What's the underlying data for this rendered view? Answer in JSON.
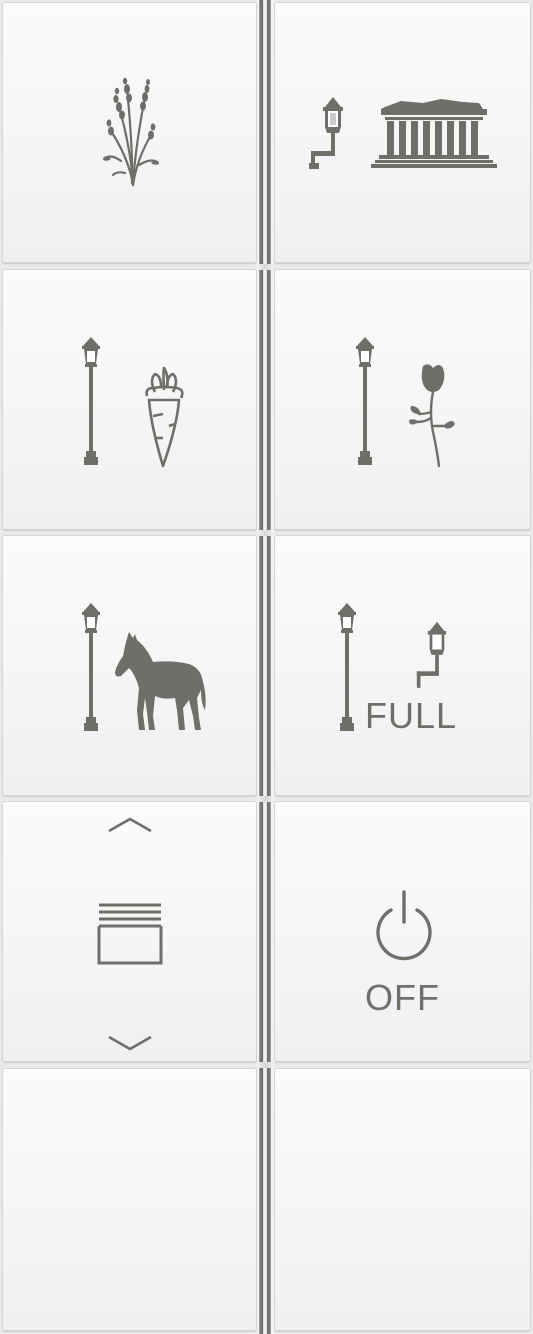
{
  "panel": {
    "icon_color": "#6f6e69",
    "buttons": [
      {
        "id": "b1",
        "icons": [
          "lavender-icon"
        ]
      },
      {
        "id": "b2",
        "icons": [
          "wall-lantern-icon",
          "parthenon-icon"
        ]
      },
      {
        "id": "b3",
        "icons": [
          "lamp-post-icon",
          "carrot-icon"
        ]
      },
      {
        "id": "b4",
        "icons": [
          "lamp-post-icon",
          "rose-icon"
        ]
      },
      {
        "id": "b5",
        "icons": [
          "lamp-post-icon",
          "horse-icon"
        ]
      },
      {
        "id": "b6",
        "icons": [
          "lamp-post-icon",
          "wall-lantern-icon"
        ],
        "label": "FULL"
      },
      {
        "id": "b7",
        "icons": [
          "chevron-up-icon",
          "blind-icon",
          "chevron-down-icon"
        ]
      },
      {
        "id": "b8",
        "icons": [
          "power-icon"
        ],
        "label": "OFF"
      },
      {
        "id": "b9",
        "icons": []
      },
      {
        "id": "b10",
        "icons": []
      }
    ]
  }
}
